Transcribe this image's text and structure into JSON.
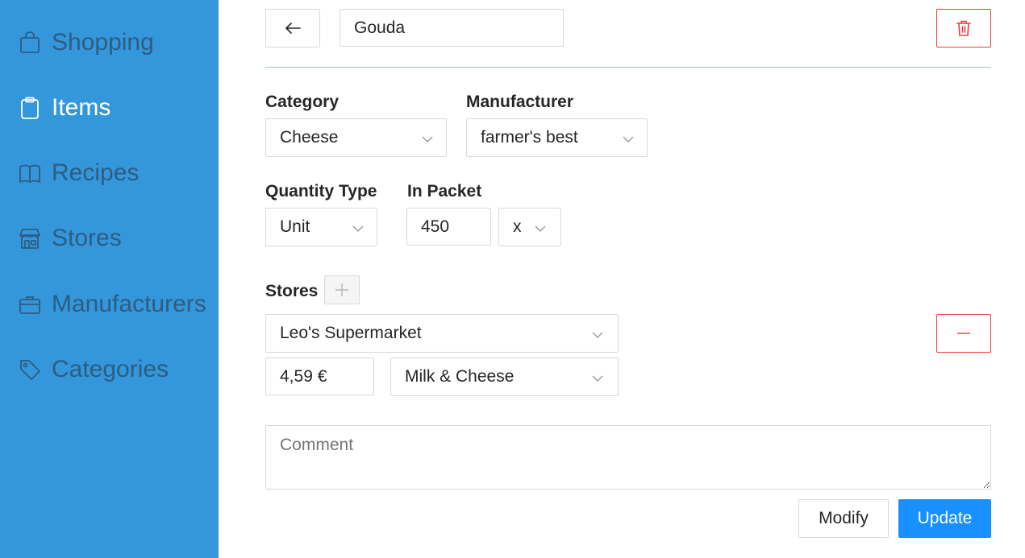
{
  "sidebar": {
    "items": [
      {
        "label": "Shopping",
        "icon": "shopping-bag-icon"
      },
      {
        "label": "Items",
        "icon": "clipboard-icon"
      },
      {
        "label": "Recipes",
        "icon": "book-icon"
      },
      {
        "label": "Stores",
        "icon": "shop-icon"
      },
      {
        "label": "Manufacturers",
        "icon": "briefcase-icon"
      },
      {
        "label": "Categories",
        "icon": "tag-icon"
      }
    ],
    "active": "Items",
    "background": "#3597db"
  },
  "header": {
    "back_icon": "arrow-left-icon",
    "name_value": "Gouda",
    "delete_icon": "trash-icon"
  },
  "form": {
    "category": {
      "label": "Category",
      "value": "Cheese"
    },
    "manufacturer": {
      "label": "Manufacturer",
      "value": "farmer's best"
    },
    "quantity_type": {
      "label": "Quantity Type",
      "value": "Unit"
    },
    "in_packet": {
      "label": "In Packet",
      "value": "450",
      "unit": "x"
    },
    "stores": {
      "label": "Stores",
      "add_icon": "plus-icon",
      "remove_icon": "minus-icon",
      "entries": [
        {
          "store": "Leo's Supermarket",
          "price": "4,59 €",
          "section": "Milk & Cheese"
        }
      ]
    },
    "comment": {
      "placeholder": "Comment",
      "value": ""
    }
  },
  "actions": {
    "modify_label": "Modify",
    "update_label": "Update"
  },
  "colors": {
    "primary": "#1890ff",
    "danger": "#f03c3c",
    "sidebar_text": "#2c5d82"
  }
}
